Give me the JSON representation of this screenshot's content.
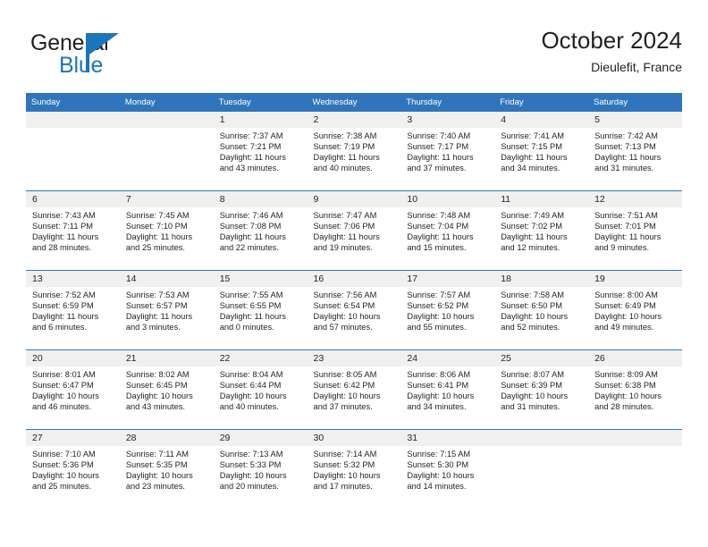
{
  "brand": {
    "word1": "General",
    "word2": "Blue",
    "triangle_color": "#1b75bb",
    "text_color": "#231f20"
  },
  "header": {
    "title": "October 2024",
    "subtitle": "Dieulefit, France"
  },
  "theme": {
    "header_bg": "#3075bc",
    "header_text": "#ffffff",
    "daynum_bg": "#f0f0f0",
    "cell_bg": "#ffffff",
    "body_text": "#231f20"
  },
  "weekdays": [
    "Sunday",
    "Monday",
    "Tuesday",
    "Wednesday",
    "Thursday",
    "Friday",
    "Saturday"
  ],
  "weeks": [
    [
      {
        "day": "",
        "lines": []
      },
      {
        "day": "",
        "lines": []
      },
      {
        "day": "1",
        "lines": [
          "Sunrise: 7:37 AM",
          "Sunset: 7:21 PM",
          "Daylight: 11 hours",
          "and 43 minutes."
        ]
      },
      {
        "day": "2",
        "lines": [
          "Sunrise: 7:38 AM",
          "Sunset: 7:19 PM",
          "Daylight: 11 hours",
          "and 40 minutes."
        ]
      },
      {
        "day": "3",
        "lines": [
          "Sunrise: 7:40 AM",
          "Sunset: 7:17 PM",
          "Daylight: 11 hours",
          "and 37 minutes."
        ]
      },
      {
        "day": "4",
        "lines": [
          "Sunrise: 7:41 AM",
          "Sunset: 7:15 PM",
          "Daylight: 11 hours",
          "and 34 minutes."
        ]
      },
      {
        "day": "5",
        "lines": [
          "Sunrise: 7:42 AM",
          "Sunset: 7:13 PM",
          "Daylight: 11 hours",
          "and 31 minutes."
        ]
      }
    ],
    [
      {
        "day": "6",
        "lines": [
          "Sunrise: 7:43 AM",
          "Sunset: 7:11 PM",
          "Daylight: 11 hours",
          "and 28 minutes."
        ]
      },
      {
        "day": "7",
        "lines": [
          "Sunrise: 7:45 AM",
          "Sunset: 7:10 PM",
          "Daylight: 11 hours",
          "and 25 minutes."
        ]
      },
      {
        "day": "8",
        "lines": [
          "Sunrise: 7:46 AM",
          "Sunset: 7:08 PM",
          "Daylight: 11 hours",
          "and 22 minutes."
        ]
      },
      {
        "day": "9",
        "lines": [
          "Sunrise: 7:47 AM",
          "Sunset: 7:06 PM",
          "Daylight: 11 hours",
          "and 19 minutes."
        ]
      },
      {
        "day": "10",
        "lines": [
          "Sunrise: 7:48 AM",
          "Sunset: 7:04 PM",
          "Daylight: 11 hours",
          "and 15 minutes."
        ]
      },
      {
        "day": "11",
        "lines": [
          "Sunrise: 7:49 AM",
          "Sunset: 7:02 PM",
          "Daylight: 11 hours",
          "and 12 minutes."
        ]
      },
      {
        "day": "12",
        "lines": [
          "Sunrise: 7:51 AM",
          "Sunset: 7:01 PM",
          "Daylight: 11 hours",
          "and 9 minutes."
        ]
      }
    ],
    [
      {
        "day": "13",
        "lines": [
          "Sunrise: 7:52 AM",
          "Sunset: 6:59 PM",
          "Daylight: 11 hours",
          "and 6 minutes."
        ]
      },
      {
        "day": "14",
        "lines": [
          "Sunrise: 7:53 AM",
          "Sunset: 6:57 PM",
          "Daylight: 11 hours",
          "and 3 minutes."
        ]
      },
      {
        "day": "15",
        "lines": [
          "Sunrise: 7:55 AM",
          "Sunset: 6:55 PM",
          "Daylight: 11 hours",
          "and 0 minutes."
        ]
      },
      {
        "day": "16",
        "lines": [
          "Sunrise: 7:56 AM",
          "Sunset: 6:54 PM",
          "Daylight: 10 hours",
          "and 57 minutes."
        ]
      },
      {
        "day": "17",
        "lines": [
          "Sunrise: 7:57 AM",
          "Sunset: 6:52 PM",
          "Daylight: 10 hours",
          "and 55 minutes."
        ]
      },
      {
        "day": "18",
        "lines": [
          "Sunrise: 7:58 AM",
          "Sunset: 6:50 PM",
          "Daylight: 10 hours",
          "and 52 minutes."
        ]
      },
      {
        "day": "19",
        "lines": [
          "Sunrise: 8:00 AM",
          "Sunset: 6:49 PM",
          "Daylight: 10 hours",
          "and 49 minutes."
        ]
      }
    ],
    [
      {
        "day": "20",
        "lines": [
          "Sunrise: 8:01 AM",
          "Sunset: 6:47 PM",
          "Daylight: 10 hours",
          "and 46 minutes."
        ]
      },
      {
        "day": "21",
        "lines": [
          "Sunrise: 8:02 AM",
          "Sunset: 6:45 PM",
          "Daylight: 10 hours",
          "and 43 minutes."
        ]
      },
      {
        "day": "22",
        "lines": [
          "Sunrise: 8:04 AM",
          "Sunset: 6:44 PM",
          "Daylight: 10 hours",
          "and 40 minutes."
        ]
      },
      {
        "day": "23",
        "lines": [
          "Sunrise: 8:05 AM",
          "Sunset: 6:42 PM",
          "Daylight: 10 hours",
          "and 37 minutes."
        ]
      },
      {
        "day": "24",
        "lines": [
          "Sunrise: 8:06 AM",
          "Sunset: 6:41 PM",
          "Daylight: 10 hours",
          "and 34 minutes."
        ]
      },
      {
        "day": "25",
        "lines": [
          "Sunrise: 8:07 AM",
          "Sunset: 6:39 PM",
          "Daylight: 10 hours",
          "and 31 minutes."
        ]
      },
      {
        "day": "26",
        "lines": [
          "Sunrise: 8:09 AM",
          "Sunset: 6:38 PM",
          "Daylight: 10 hours",
          "and 28 minutes."
        ]
      }
    ],
    [
      {
        "day": "27",
        "lines": [
          "Sunrise: 7:10 AM",
          "Sunset: 5:36 PM",
          "Daylight: 10 hours",
          "and 25 minutes."
        ]
      },
      {
        "day": "28",
        "lines": [
          "Sunrise: 7:11 AM",
          "Sunset: 5:35 PM",
          "Daylight: 10 hours",
          "and 23 minutes."
        ]
      },
      {
        "day": "29",
        "lines": [
          "Sunrise: 7:13 AM",
          "Sunset: 5:33 PM",
          "Daylight: 10 hours",
          "and 20 minutes."
        ]
      },
      {
        "day": "30",
        "lines": [
          "Sunrise: 7:14 AM",
          "Sunset: 5:32 PM",
          "Daylight: 10 hours",
          "and 17 minutes."
        ]
      },
      {
        "day": "31",
        "lines": [
          "Sunrise: 7:15 AM",
          "Sunset: 5:30 PM",
          "Daylight: 10 hours",
          "and 14 minutes."
        ]
      },
      {
        "day": "",
        "lines": []
      },
      {
        "day": "",
        "lines": []
      }
    ]
  ]
}
